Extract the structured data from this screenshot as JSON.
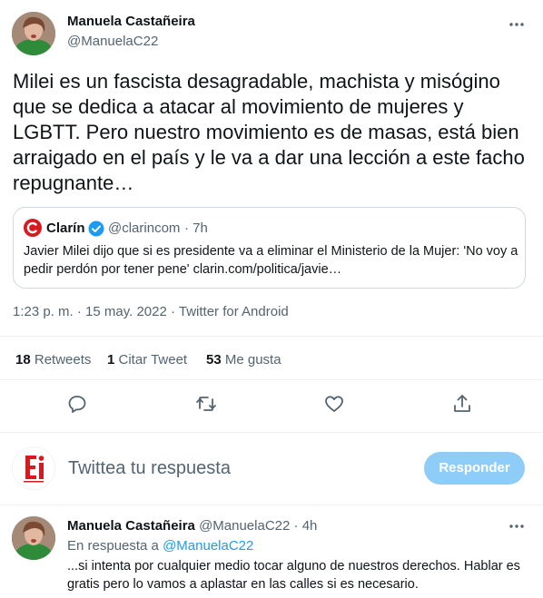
{
  "tweet": {
    "author_name": "Manuela Castañeira",
    "author_handle": "@ManuelaC22",
    "text": "Milei es un fascista desagradable, machista y misógino que se dedica a atacar al movimiento de mujeres y LGBTT. Pero nuestro movimiento es de masas, está bien arraigado en el país y le va a dar una lección a este facho repugnante…",
    "quoted": {
      "source_name": "Clarín",
      "source_handle": "@clarincom",
      "age": "· 7h",
      "text": "Javier Milei dijo que si es presidente va a eliminar el Ministerio de la Mujer: 'No voy a pedir perdón por tener pene' clarin.com/politica/javie…"
    },
    "timestamp": "1:23 p. m. · 15 may. 2022 · Twitter for Android",
    "stats": {
      "retweets_count": "18",
      "retweets_label": "Retweets",
      "quotes_count": "1",
      "quotes_label": "Citar Tweet",
      "likes_count": "53",
      "likes_label": "Me gusta"
    }
  },
  "compose": {
    "placeholder": "Twittea tu respuesta",
    "reply_button": "Responder",
    "avatar_text": "Ei"
  },
  "reply": {
    "author_name": "Manuela Castañeira",
    "author_handle": "@ManuelaC22",
    "age": "· 4h",
    "in_reply_prefix": "En respuesta a",
    "in_reply_handle": "@ManuelaC22",
    "text": "...si intenta por cualquier medio tocar alguno de nuestros derechos. Hablar es gratis pero lo vamos a aplastar en las calles si es necesario."
  },
  "colors": {
    "accent": "#1d9bf0",
    "reply_button_disabled": "#8ecdf8",
    "muted_text": "#536471",
    "brand_red": "#d71920"
  }
}
